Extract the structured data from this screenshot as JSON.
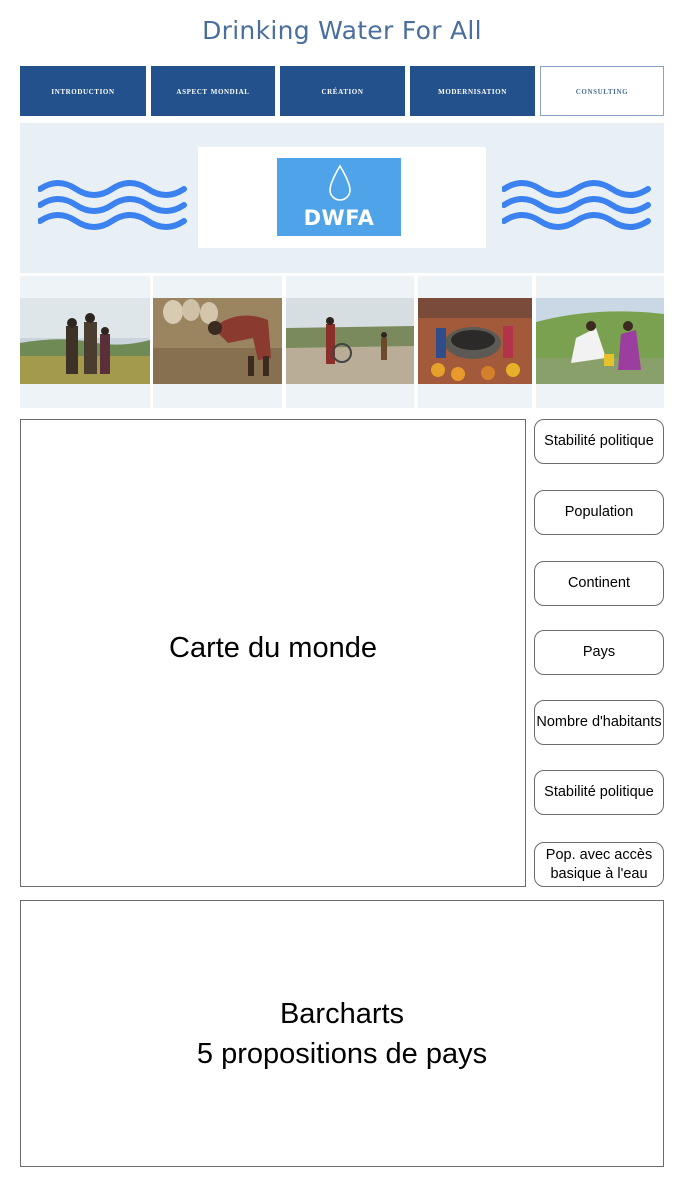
{
  "header": {
    "title": "Drinking Water For All"
  },
  "nav": {
    "items": [
      {
        "label": "Introduction"
      },
      {
        "label": "Aspect mondial"
      },
      {
        "label": "Création"
      },
      {
        "label": "Modernisation"
      },
      {
        "label": "Consulting"
      }
    ]
  },
  "banner": {
    "logo_text": "DWFA"
  },
  "photos": [
    {
      "icon": "children-field-photo"
    },
    {
      "icon": "woman-working-photo"
    },
    {
      "icon": "people-road-photo"
    },
    {
      "icon": "water-well-photo"
    },
    {
      "icon": "women-water-photo"
    }
  ],
  "map": {
    "label": "Carte du monde"
  },
  "side_buttons": [
    {
      "label": "Stabilité politique"
    },
    {
      "label": "Population"
    },
    {
      "label": "Continent"
    },
    {
      "label": "Pays"
    },
    {
      "label": "Nombre d'habitants"
    },
    {
      "label": "Stabilité politique"
    },
    {
      "label": "Pop. avec accès basique à l'eau"
    }
  ],
  "barcharts": {
    "line1": "Barcharts",
    "line2": "5 propositions de pays"
  },
  "colors": {
    "nav_bg": "#22518c",
    "title": "#4a6f9c",
    "banner_bg": "#e9f0f5",
    "wave": "#3b82f0",
    "logo_bg": "#4fa3e8"
  }
}
